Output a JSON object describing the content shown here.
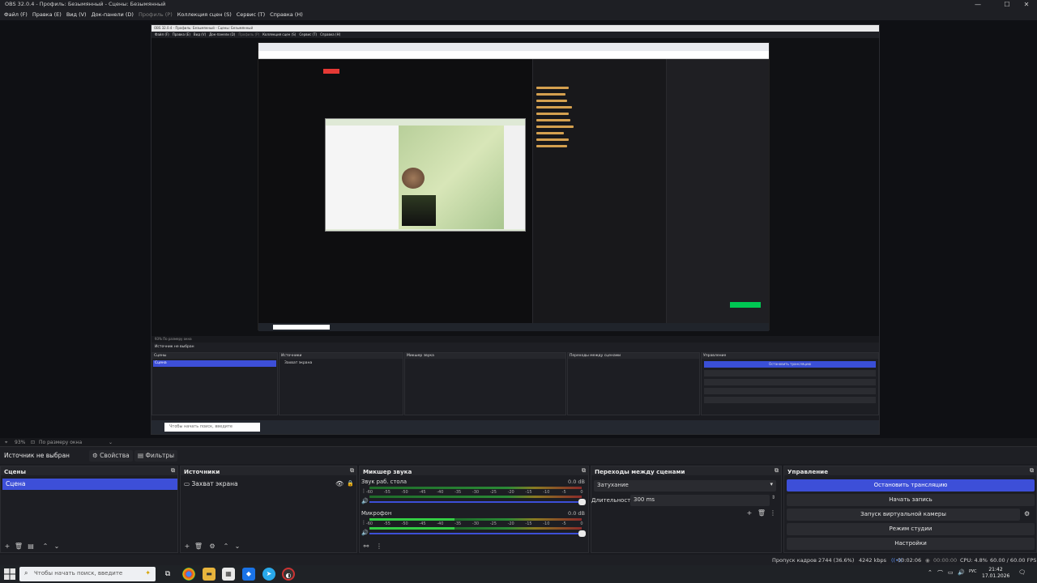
{
  "window": {
    "title": "OBS 32.0.4 - Профиль: Безымянный - Сцены: Безымянный",
    "controls": [
      "—",
      "☐",
      "✕"
    ]
  },
  "menu": [
    "Файл (F)",
    "Правка (E)",
    "Вид (V)",
    "Док-панели (D)",
    "Профиль (P)",
    "Коллекция сцен (S)",
    "Сервис (T)",
    "Справка (H)"
  ],
  "preview_status": {
    "zoom": "93%",
    "fit": "По размеру окна"
  },
  "source_bar": {
    "no_source": "Источник не выбран",
    "properties": "Свойства",
    "filters": "Фильтры"
  },
  "docks": {
    "scenes": {
      "title": "Сцены",
      "items": [
        "Сцена"
      ]
    },
    "sources": {
      "title": "Источники",
      "items": [
        "Захват экрана"
      ]
    },
    "mixer": {
      "title": "Микшер звука",
      "channels": [
        {
          "name": "Звук раб. стола",
          "db": "0.0 dB",
          "level": 0
        },
        {
          "name": "Микрофон",
          "db": "0.0 dB",
          "level": 0.4
        }
      ],
      "ticks": [
        "-60",
        "-55",
        "-50",
        "-45",
        "-40",
        "-35",
        "-30",
        "-25",
        "-20",
        "-15",
        "-10",
        "-5",
        "0"
      ]
    },
    "transitions": {
      "title": "Переходы между сценами",
      "selected": "Затухание",
      "duration_label": "Длительность",
      "duration": "300 ms"
    },
    "controls": {
      "title": "Управление",
      "buttons": [
        "Остановить трансляцию",
        "Начать запись",
        "Запуск виртуальной камеры",
        "Режим студии",
        "Настройки"
      ]
    }
  },
  "stats": {
    "dropped": "Пропуск кадров 2744 (36.6%)",
    "bitrate": "4242 kbps",
    "stream_time": "00:02:06",
    "rec_time": "00:00:00",
    "cpu": "CPU: 4.8%",
    "fps": "60.00 / 60.00 FPS"
  },
  "taskbar": {
    "search_placeholder": "Чтобы начать поиск, введите",
    "lang": "РУС",
    "time": "21:42",
    "date": "17.01.2026"
  },
  "inner": {
    "title": "OBS 32.0.4 - Профиль: Безымянный - Сцены: Безымянный",
    "status": "93%   По размеру окна",
    "src": "Источник не выбран",
    "docks": [
      "Сцены",
      "Источники",
      "Микшер звука",
      "Переходы между сценами",
      "Управление"
    ],
    "scene": "Сцена",
    "source": "Захват экрана",
    "stop_btn": "Остановить трансляцию"
  },
  "colors": {
    "accent": "#3d4fd8",
    "twitch_green": "#00c853"
  }
}
